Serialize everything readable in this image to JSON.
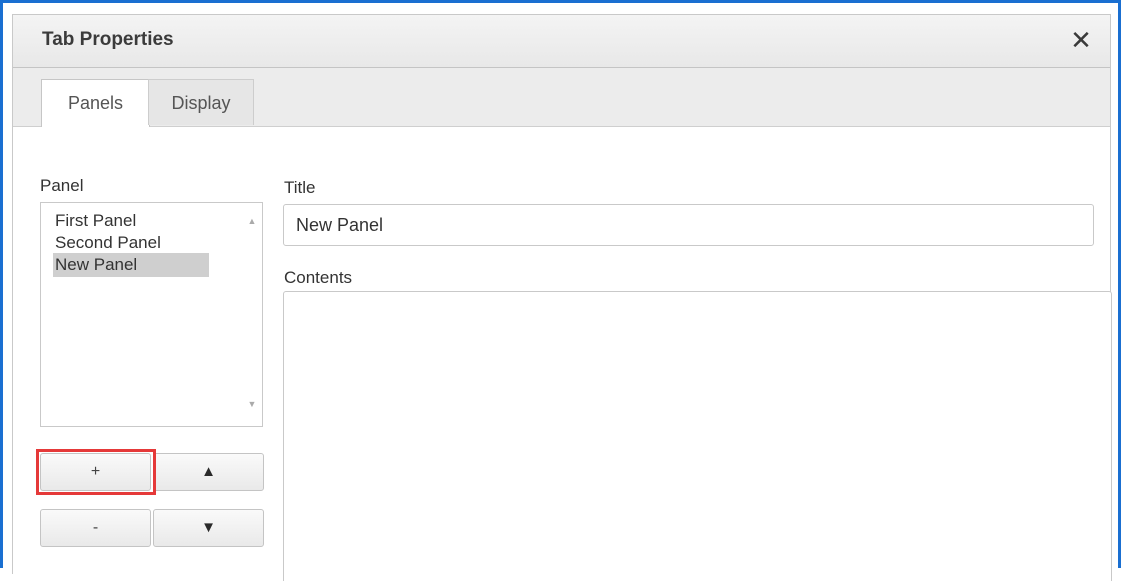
{
  "dialog": {
    "title": "Tab Properties",
    "close_glyph": "✕"
  },
  "tabs": [
    {
      "label": "Panels",
      "active": true
    },
    {
      "label": "Display",
      "active": false
    }
  ],
  "panel_list": {
    "label": "Panel",
    "items": [
      "First Panel",
      "Second Panel",
      "New Panel"
    ],
    "selected": "New Panel"
  },
  "title_field": {
    "label": "Title",
    "value": "New Panel"
  },
  "contents_field": {
    "label": "Contents",
    "value": ""
  },
  "buttons": {
    "add": "+",
    "remove": "-",
    "move_up": "▲",
    "move_down": "▼"
  },
  "colors": {
    "frame_border": "#1a6fd1",
    "highlight": "#e53939",
    "selected_item_bg": "#cfcfcf"
  }
}
